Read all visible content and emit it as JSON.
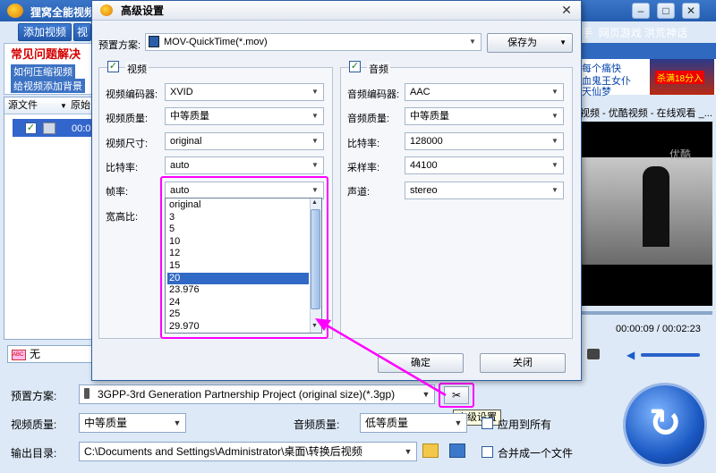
{
  "main_window": {
    "title": "狸窝全能视频转换器",
    "toolbar": {
      "add_video": "添加视频",
      "edit": "视"
    },
    "faq": {
      "title": "常见问题解决",
      "links": [
        "如何压缩视频",
        "给视频添加背景"
      ]
    },
    "file_list": {
      "col_source": "源文件",
      "col_original": "原始",
      "row_time": "00:0"
    },
    "subtitle_value": "无",
    "right_panel": {
      "links_top": [
        "手",
        "网页游戏",
        "洪荒神话"
      ],
      "ad_text": [
        "每个痛快",
        "血鬼王女仆",
        "天仙梦"
      ],
      "ad_banner": "杀满18分入",
      "video_title": "视频 - 优酷视频 - 在线观看 _...",
      "video_logo": "优酷",
      "time_current": "00:00:09",
      "time_total": "00:02:23"
    },
    "bottom": {
      "preset_label": "预置方案:",
      "preset_value": "3GPP-3rd Generation Partnership Project (original size)(*.3gp)",
      "video_quality_label": "视频质量:",
      "video_quality_value": "中等质量",
      "audio_quality_label": "音频质量:",
      "audio_quality_value": "低等质量",
      "apply_all": "应用到所有",
      "output_label": "输出目录:",
      "output_path": "C:\\Documents and Settings\\Administrator\\桌面\\转换后视频",
      "merge_label": "合并成一个文件",
      "tooltip": "高级设置"
    }
  },
  "dialog": {
    "title": "高级设置",
    "preset_label": "预置方案:",
    "preset_value": "MOV-QuickTime(*.mov)",
    "save_as": "保存为",
    "video_group": "视频",
    "audio_group": "音频",
    "video": {
      "encoder_label": "视频编码器:",
      "encoder": "XVID",
      "quality_label": "视频质量:",
      "quality": "中等质量",
      "size_label": "视频尺寸:",
      "size": "original",
      "bitrate_label": "比特率:",
      "bitrate": "auto",
      "framerate_label": "帧率:",
      "framerate": "auto",
      "aspect_label": "宽高比:"
    },
    "audio": {
      "encoder_label": "音频编码器:",
      "encoder": "AAC",
      "quality_label": "音频质量:",
      "quality": "中等质量",
      "bitrate_label": "比特率:",
      "bitrate": "128000",
      "samplerate_label": "采样率:",
      "samplerate": "44100",
      "channels_label": "声道:",
      "channels": "stereo"
    },
    "framerate_options": [
      "original",
      "3",
      "5",
      "10",
      "12",
      "15",
      "20",
      "23.976",
      "24",
      "25",
      "29.970"
    ],
    "framerate_highlighted": "20",
    "ok": "确定",
    "close": "关闭"
  },
  "colors": {
    "highlight": "#ff00ff",
    "selection": "#3169c6",
    "title_bar": "#2a62b8"
  }
}
